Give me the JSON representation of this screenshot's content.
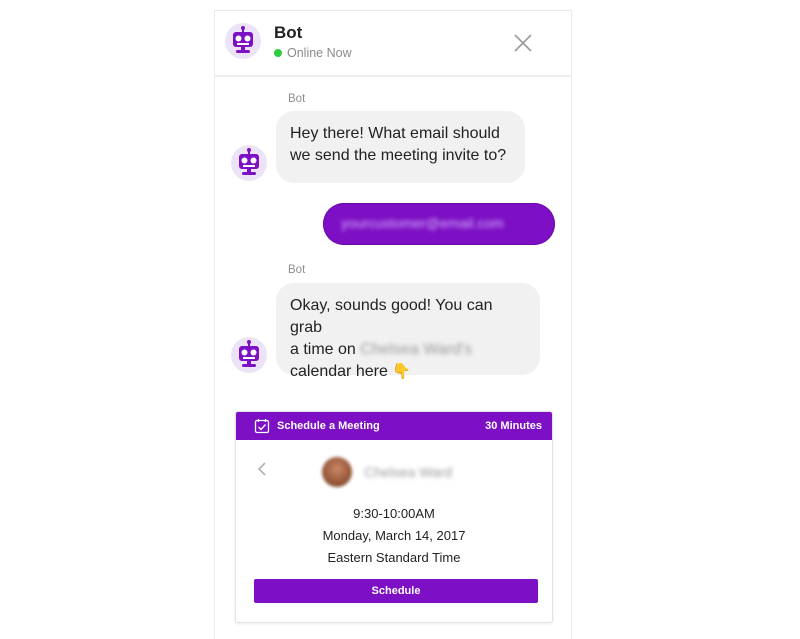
{
  "header": {
    "bot_name": "Bot",
    "status": "Online Now",
    "avatar_icon": "robot-icon",
    "close_icon": "close-icon"
  },
  "messages": [
    {
      "sender": "Bot",
      "line1": "Hey there! What email should",
      "line2": "we send the meeting invite to?"
    },
    {
      "sender": "user",
      "text": "yourcustomer@email.com"
    },
    {
      "sender": "Bot",
      "line1": "Okay, sounds good! You can grab",
      "line2_prefix": "a time on",
      "line2_name": "Chelsea Ward's",
      "line3": "calendar here",
      "emoji": "👇"
    }
  ],
  "scheduler": {
    "title": "Schedule a Meeting",
    "duration": "30 Minutes",
    "host_name": "Chelsea Ward",
    "time": "9:30-10:00AM",
    "date": "Monday, March 14, 2017",
    "timezone": "Eastern Standard Time",
    "button_label": "Schedule"
  },
  "colors": {
    "accent": "#7d0fc4",
    "bubble_bg": "#f1f1f1",
    "status_online": "#2ecc40"
  }
}
